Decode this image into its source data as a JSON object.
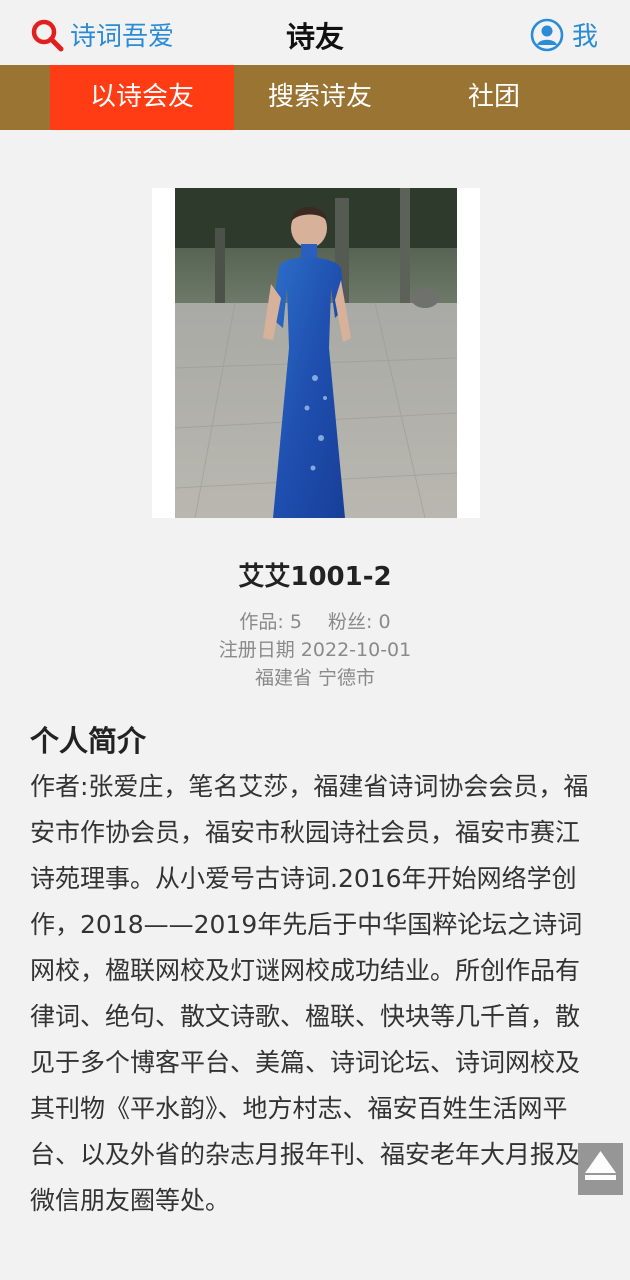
{
  "header": {
    "brand_label": "诗词吾爱",
    "title": "诗友",
    "me_label": "我"
  },
  "tabs": [
    {
      "label": "以诗会友",
      "active": true
    },
    {
      "label": "搜索诗友",
      "active": false
    },
    {
      "label": "社团",
      "active": false
    }
  ],
  "profile": {
    "username": "艾艾1001-2",
    "works_label": "作品: 5",
    "fans_label": "粉丝: 0",
    "registered": "注册日期 2022-10-01",
    "location": "福建省 宁德市"
  },
  "bio": {
    "title": "个人简介",
    "text": "作者:张爱庄，笔名艾莎，福建省诗词协会会员，福安市作协会员，福安市秋园诗社会员，福安市赛江诗苑理事。从小爱号古诗词.2016年开始网络学创作，2018——2019年先后于中华国粹论坛之诗词网校，楹联网校及灯谜网校成功结业。所创作品有律词、绝句、散文诗歌、楹联、快块等几千首，散见于多个博客平台、美篇、诗词论坛、诗词网校及其刊物《平水韵》、地方村志、福安百姓生活网平台、以及外省的杂志月报年刊、福安老年大月报及微信朋友圈等处。"
  },
  "colors": {
    "accent_blue": "#2a8bd6",
    "tab_bar": "#9a7433",
    "tab_active": "#ff3c13",
    "background": "#f2f2f2"
  },
  "icons": {
    "brand": "search-icon",
    "me": "user-circle-icon",
    "scroll_top": "arrow-up-icon"
  }
}
